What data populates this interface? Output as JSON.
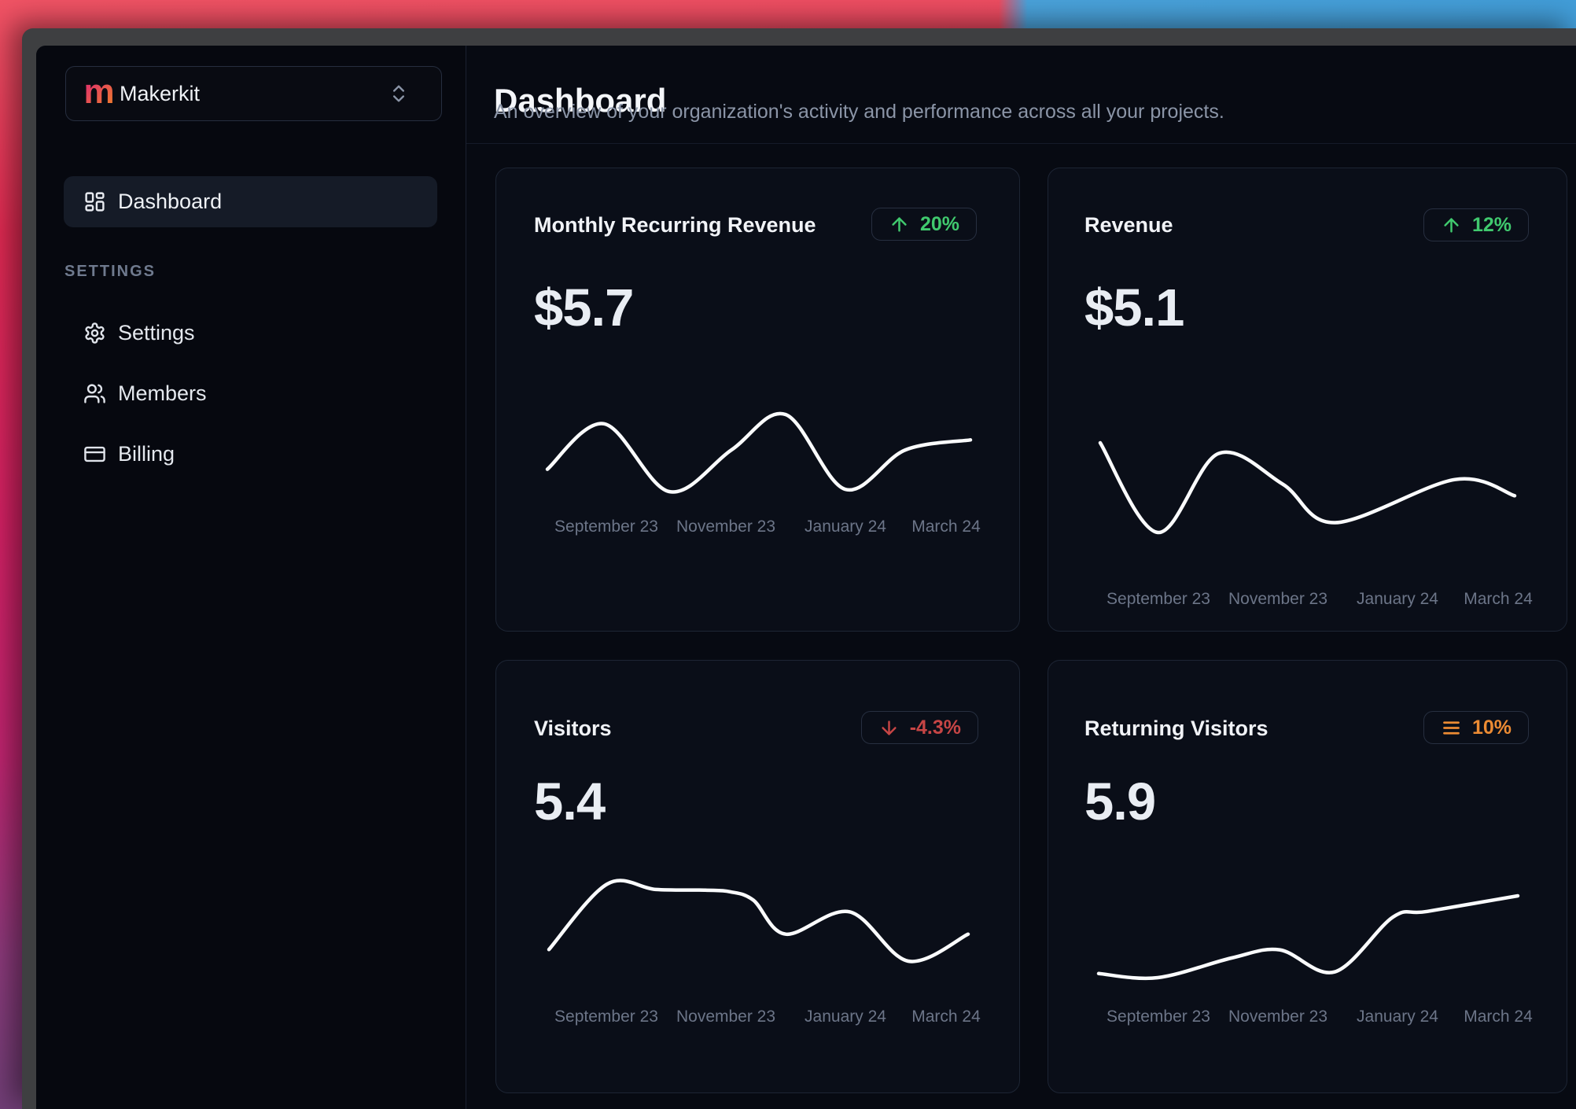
{
  "workspace": {
    "name": "Makerkit",
    "logo_letter": "m"
  },
  "sidebar": {
    "nav": [
      {
        "label": "Dashboard",
        "icon": "layout-dashboard-icon",
        "active": true
      }
    ],
    "section_label": "SETTINGS",
    "items": [
      {
        "label": "Settings",
        "icon": "gear-icon"
      },
      {
        "label": "Members",
        "icon": "users-icon"
      },
      {
        "label": "Billing",
        "icon": "credit-card-icon"
      }
    ]
  },
  "header": {
    "title": "Dashboard",
    "subtitle": "An overview of your organization's activity and performance across all your projects."
  },
  "cards": [
    {
      "title": "Monthly Recurring Revenue",
      "value": "$5.7",
      "trend": "up",
      "trend_label": "20%",
      "trend_icon": "arrow-up-icon",
      "trend_color": "#40c96e"
    },
    {
      "title": "Revenue",
      "value": "$5.1",
      "trend": "up",
      "trend_label": "12%",
      "trend_icon": "arrow-up-icon",
      "trend_color": "#40c96e"
    },
    {
      "title": "Visitors",
      "value": "5.4",
      "trend": "down",
      "trend_label": "-4.3%",
      "trend_icon": "arrow-down-icon",
      "trend_color": "#c64545"
    },
    {
      "title": "Returning Visitors",
      "value": "5.9",
      "trend": "neutral",
      "trend_label": "10%",
      "trend_icon": "menu-icon",
      "trend_color": "#ec8b33"
    }
  ],
  "chart_data": [
    {
      "type": "line",
      "name": "Monthly Recurring Revenue sparkline",
      "x_labels": [
        "September 23",
        "November 23",
        "January 24",
        "March 24"
      ],
      "points": [
        {
          "x": 0,
          "v": 29
        },
        {
          "x": 0.134,
          "v": 88
        },
        {
          "x": 0.288,
          "v": 0
        },
        {
          "x": 0.435,
          "v": 54
        },
        {
          "x": 0.563,
          "v": 100
        },
        {
          "x": 0.704,
          "v": 3
        },
        {
          "x": 0.846,
          "v": 54
        },
        {
          "x": 1,
          "v": 67
        }
      ],
      "ylim": [
        0,
        100
      ],
      "grid": false,
      "legend": false
    },
    {
      "type": "line",
      "name": "Revenue sparkline",
      "x_labels": [
        "September 23",
        "November 23",
        "January 24",
        "March 24"
      ],
      "points": [
        {
          "x": 0,
          "v": 100
        },
        {
          "x": 0.139,
          "v": 0
        },
        {
          "x": 0.285,
          "v": 88
        },
        {
          "x": 0.44,
          "v": 54
        },
        {
          "x": 0.567,
          "v": 11
        },
        {
          "x": 0.856,
          "v": 59
        },
        {
          "x": 1,
          "v": 41
        }
      ],
      "ylim": [
        0,
        100
      ],
      "grid": false,
      "legend": false
    },
    {
      "type": "line",
      "name": "Visitors sparkline",
      "x_labels": [
        "September 23",
        "November 23",
        "January 24",
        "March 24"
      ],
      "points": [
        {
          "x": 0,
          "v": 15
        },
        {
          "x": 0.139,
          "v": 100
        },
        {
          "x": 0.255,
          "v": 93
        },
        {
          "x": 0.373,
          "v": 92
        },
        {
          "x": 0.432,
          "v": 90
        },
        {
          "x": 0.488,
          "v": 79
        },
        {
          "x": 0.565,
          "v": 35
        },
        {
          "x": 0.717,
          "v": 64
        },
        {
          "x": 0.857,
          "v": 0
        },
        {
          "x": 1,
          "v": 35
        }
      ],
      "ylim": [
        0,
        100
      ],
      "grid": false,
      "legend": false
    },
    {
      "type": "line",
      "name": "Returning Visitors sparkline",
      "x_labels": [
        "September 23",
        "November 23",
        "January 24",
        "March 24"
      ],
      "points": [
        {
          "x": 0,
          "v": 5
        },
        {
          "x": 0.141,
          "v": 0
        },
        {
          "x": 0.317,
          "v": 24
        },
        {
          "x": 0.432,
          "v": 34
        },
        {
          "x": 0.563,
          "v": 7
        },
        {
          "x": 0.702,
          "v": 74
        },
        {
          "x": 0.784,
          "v": 81
        },
        {
          "x": 1,
          "v": 100
        }
      ],
      "ylim": [
        0,
        100
      ],
      "grid": false,
      "legend": false
    }
  ],
  "colors": {
    "positive": "#40c96e",
    "negative": "#c64545",
    "neutral": "#ec8b33",
    "sparkline": "#fafbfc",
    "wallpaper_pink": "#e02a52",
    "wallpaper_purple": "#664074",
    "wallpaper_blue": "#4aa2da",
    "window_frame": "#3e3f41"
  }
}
